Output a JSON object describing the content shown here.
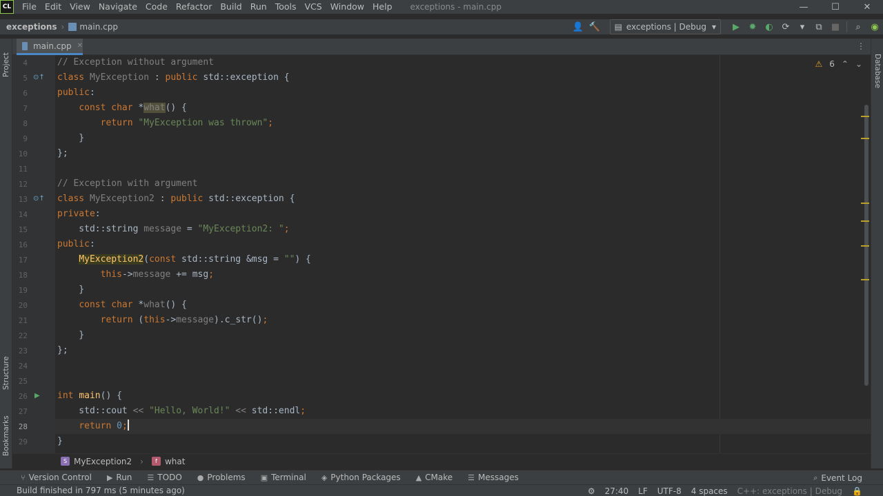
{
  "app": {
    "logo": "CL",
    "window_title": "exceptions - main.cpp",
    "menu": [
      "File",
      "Edit",
      "View",
      "Navigate",
      "Code",
      "Refactor",
      "Build",
      "Run",
      "Tools",
      "VCS",
      "Window",
      "Help"
    ]
  },
  "nav": {
    "project": "exceptions",
    "file": "main.cpp",
    "run_config": "exceptions | Debug"
  },
  "tabs": [
    {
      "label": "main.cpp",
      "active": true
    }
  ],
  "sidebars": {
    "left": [
      "Project",
      "Structure",
      "Bookmarks"
    ],
    "right": [
      "Database"
    ]
  },
  "editor": {
    "warning_count": "6",
    "current_line": 28,
    "lines": [
      {
        "n": "4",
        "tokens": [
          {
            "t": "// Exception without argument",
            "c": "cm"
          }
        ]
      },
      {
        "n": "5",
        "mark": "impl",
        "tokens": [
          {
            "t": "class ",
            "c": "kw"
          },
          {
            "t": "MyException",
            "c": "dim"
          },
          {
            "t": " : ",
            "c": ""
          },
          {
            "t": "public ",
            "c": "kw"
          },
          {
            "t": "std::exception {",
            "c": ""
          }
        ]
      },
      {
        "n": "6",
        "tokens": [
          {
            "t": "public",
            "c": "kw"
          },
          {
            "t": ":",
            "c": ""
          }
        ]
      },
      {
        "n": "7",
        "tokens": [
          {
            "t": "    ",
            "c": ""
          },
          {
            "t": "const ",
            "c": "kw"
          },
          {
            "t": "char ",
            "c": "kw"
          },
          {
            "t": "*",
            "c": ""
          },
          {
            "t": "what",
            "c": "dim hl2"
          },
          {
            "t": "() {",
            "c": ""
          }
        ]
      },
      {
        "n": "8",
        "tokens": [
          {
            "t": "        ",
            "c": ""
          },
          {
            "t": "return ",
            "c": "kw"
          },
          {
            "t": "\"MyException was thrown\"",
            "c": "str"
          },
          {
            "t": ";",
            "c": "kw"
          }
        ]
      },
      {
        "n": "9",
        "tokens": [
          {
            "t": "    }",
            "c": ""
          }
        ]
      },
      {
        "n": "10",
        "tokens": [
          {
            "t": "};",
            "c": ""
          }
        ]
      },
      {
        "n": "11",
        "tokens": []
      },
      {
        "n": "12",
        "tokens": [
          {
            "t": "// Exception with argument",
            "c": "cm"
          }
        ]
      },
      {
        "n": "13",
        "mark": "impl",
        "tokens": [
          {
            "t": "class ",
            "c": "kw"
          },
          {
            "t": "MyException2",
            "c": "dim"
          },
          {
            "t": " : ",
            "c": ""
          },
          {
            "t": "public ",
            "c": "kw"
          },
          {
            "t": "std::exception {",
            "c": ""
          }
        ]
      },
      {
        "n": "14",
        "tokens": [
          {
            "t": "private",
            "c": "kw"
          },
          {
            "t": ":",
            "c": ""
          }
        ]
      },
      {
        "n": "15",
        "tokens": [
          {
            "t": "    std::string ",
            "c": ""
          },
          {
            "t": "message",
            "c": "dim"
          },
          {
            "t": " = ",
            "c": ""
          },
          {
            "t": "\"MyException2: \"",
            "c": "str"
          },
          {
            "t": ";",
            "c": "kw"
          }
        ]
      },
      {
        "n": "16",
        "tokens": [
          {
            "t": "public",
            "c": "kw"
          },
          {
            "t": ":",
            "c": ""
          }
        ]
      },
      {
        "n": "17",
        "tokens": [
          {
            "t": "    ",
            "c": ""
          },
          {
            "t": "MyException2",
            "c": "fn hl"
          },
          {
            "t": "(",
            "c": ""
          },
          {
            "t": "const ",
            "c": "kw"
          },
          {
            "t": "std::string &msg = ",
            "c": ""
          },
          {
            "t": "\"\"",
            "c": "str"
          },
          {
            "t": ") {",
            "c": ""
          }
        ]
      },
      {
        "n": "18",
        "tokens": [
          {
            "t": "        ",
            "c": ""
          },
          {
            "t": "this",
            "c": "kw"
          },
          {
            "t": "->",
            "c": ""
          },
          {
            "t": "message",
            "c": "dim"
          },
          {
            "t": " += msg",
            "c": ""
          },
          {
            "t": ";",
            "c": "kw"
          }
        ]
      },
      {
        "n": "19",
        "tokens": [
          {
            "t": "    }",
            "c": ""
          }
        ]
      },
      {
        "n": "20",
        "tokens": [
          {
            "t": "    ",
            "c": ""
          },
          {
            "t": "const ",
            "c": "kw"
          },
          {
            "t": "char ",
            "c": "kw"
          },
          {
            "t": "*",
            "c": ""
          },
          {
            "t": "what",
            "c": "dim"
          },
          {
            "t": "() {",
            "c": ""
          }
        ]
      },
      {
        "n": "21",
        "tokens": [
          {
            "t": "        ",
            "c": ""
          },
          {
            "t": "return ",
            "c": "kw"
          },
          {
            "t": "(",
            "c": ""
          },
          {
            "t": "this",
            "c": "kw"
          },
          {
            "t": "->",
            "c": ""
          },
          {
            "t": "message",
            "c": "dim"
          },
          {
            "t": ").c_str()",
            "c": ""
          },
          {
            "t": ";",
            "c": "kw"
          }
        ]
      },
      {
        "n": "22",
        "tokens": [
          {
            "t": "    }",
            "c": ""
          }
        ]
      },
      {
        "n": "23",
        "tokens": [
          {
            "t": "};",
            "c": ""
          }
        ]
      },
      {
        "n": "24",
        "tokens": []
      },
      {
        "n": "25",
        "tokens": []
      },
      {
        "n": "26",
        "mark": "run",
        "tokens": [
          {
            "t": "int ",
            "c": "kw"
          },
          {
            "t": "main",
            "c": "fn"
          },
          {
            "t": "() {",
            "c": ""
          }
        ]
      },
      {
        "n": "27",
        "tokens": [
          {
            "t": "    std::cout ",
            "c": ""
          },
          {
            "t": "<< ",
            "c": "dim"
          },
          {
            "t": "\"Hello, World!\"",
            "c": "str"
          },
          {
            "t": " << ",
            "c": "dim"
          },
          {
            "t": "std::endl",
            "c": ""
          },
          {
            "t": ";",
            "c": "kw"
          }
        ]
      },
      {
        "n": "28",
        "caret": true,
        "tokens": [
          {
            "t": "    ",
            "c": ""
          },
          {
            "t": "return ",
            "c": "kw"
          },
          {
            "t": "0",
            "c": "num"
          },
          {
            "t": ";",
            "c": "kw"
          }
        ]
      },
      {
        "n": "29",
        "tokens": [
          {
            "t": "}",
            "c": ""
          }
        ]
      }
    ]
  },
  "breadcrumb": {
    "items": [
      {
        "icon": "S",
        "label": "MyException2",
        "color": "#8a6fb3"
      },
      {
        "icon": "f",
        "label": "what",
        "color": "#b35a6f"
      }
    ]
  },
  "toolwindows": {
    "left": [
      {
        "icon": "branch-icon",
        "glyph": "⑂",
        "label": "Version Control"
      },
      {
        "icon": "run-icon",
        "glyph": "▶",
        "label": "Run"
      },
      {
        "icon": "todo-icon",
        "glyph": "☰",
        "label": "TODO"
      },
      {
        "icon": "problems-icon",
        "glyph": "●",
        "label": "Problems"
      },
      {
        "icon": "terminal-icon",
        "glyph": "▣",
        "label": "Terminal"
      },
      {
        "icon": "python-packages-icon",
        "glyph": "◈",
        "label": "Python Packages"
      },
      {
        "icon": "cmake-icon",
        "glyph": "▲",
        "label": "CMake"
      },
      {
        "icon": "messages-icon",
        "glyph": "☰",
        "label": "Messages"
      }
    ],
    "right": {
      "icon": "event-log-icon",
      "label": "Event Log"
    }
  },
  "status": {
    "message": "Build finished in 797 ms (5 minutes ago)",
    "position": "27:40",
    "line_sep": "LF",
    "encoding": "UTF-8",
    "indent": "4 spaces",
    "context": "C++: exceptions | Debug"
  },
  "colors": {
    "accent": "#4a88c7",
    "run_green": "#59a869",
    "warning": "#e5a227"
  }
}
